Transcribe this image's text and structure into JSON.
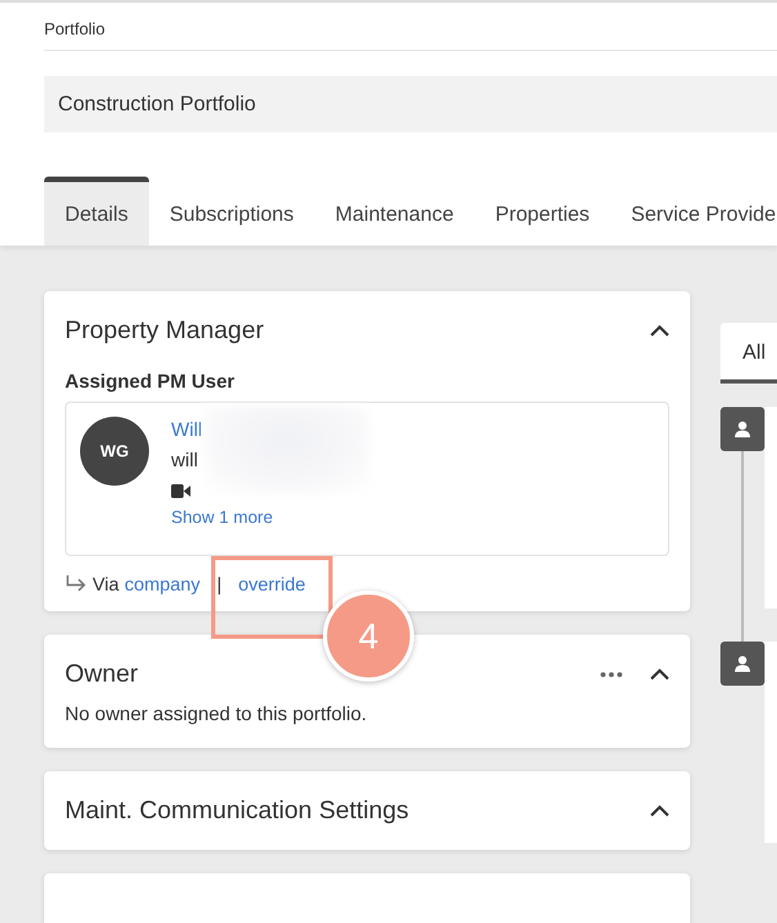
{
  "breadcrumb": "Portfolio",
  "title": "Construction Portfolio",
  "tabs": [
    {
      "label": "Details",
      "selected": true
    },
    {
      "label": "Subscriptions",
      "selected": false
    },
    {
      "label": "Maintenance",
      "selected": false
    },
    {
      "label": "Properties",
      "selected": false
    },
    {
      "label": "Service Provide",
      "selected": false
    }
  ],
  "property_manager": {
    "title": "Property Manager",
    "expanded": true,
    "subtitle": "Assigned PM User",
    "user": {
      "initials": "WG",
      "name": "Will",
      "email": "will",
      "more_link": "Show 1 more"
    },
    "via": {
      "prefix": "Via",
      "link": "company",
      "separator": "|",
      "override": "override"
    }
  },
  "owner": {
    "title": "Owner",
    "expanded": true,
    "has_menu": true,
    "text": "No owner assigned to this portfolio."
  },
  "maint": {
    "title": "Maint. Communication Settings",
    "expanded": true
  },
  "annotation": {
    "number": "4"
  },
  "activity": {
    "tab": "All",
    "entries": [
      {
        "kind": "person"
      },
      {
        "kind": "person"
      }
    ]
  }
}
